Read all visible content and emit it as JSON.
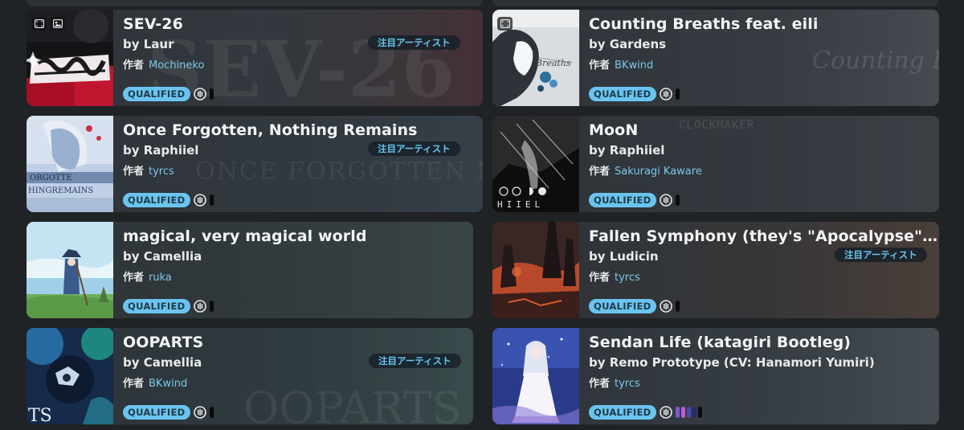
{
  "status_colors": {
    "qualified_bg": "#6bc4ef",
    "qualified_text": "#1f3a49",
    "spotlight_text": "#66c6f0",
    "mapper_name": "#7cc6ea"
  },
  "beatmaps": [
    {
      "title": "SEV-26",
      "artist": "by Laur",
      "mapper_label": "作者",
      "mapper": "Mochineko",
      "status": "QUALIFIED",
      "spotlight": "注目アーティスト",
      "has_video": true,
      "has_storyboard": true,
      "mode_icon": "osu-standard-icon",
      "difficulty_colors": [
        "#0b0b0b"
      ],
      "ghost_text": "SEV-26"
    },
    {
      "title": "Counting Breaths feat. eili",
      "artist": "by Gardens",
      "mapper_label": "作者",
      "mapper": "BKwind",
      "status": "QUALIFIED",
      "spotlight": "",
      "has_video": true,
      "has_storyboard": false,
      "mode_icon": "osu-standard-icon",
      "difficulty_colors": [
        "#0b0b0b"
      ],
      "ghost_text": "Counting Breaths"
    },
    {
      "title": "Once Forgotten, Nothing Remains",
      "artist": "by Raphiiel",
      "mapper_label": "作者",
      "mapper": "tyrcs",
      "status": "QUALIFIED",
      "spotlight": "注目アーティスト",
      "has_video": false,
      "has_storyboard": false,
      "mode_icon": "osu-standard-icon",
      "difficulty_colors": [
        "#0b0b0b"
      ],
      "ghost_text": "ONCE FORGOTTEN NOTHING REMAINS"
    },
    {
      "title": "MooN",
      "artist": "by Raphiiel",
      "mapper_label": "作者",
      "mapper": "Sakuragi Kaware",
      "status": "QUALIFIED",
      "spotlight": "",
      "has_video": false,
      "has_storyboard": false,
      "mode_icon": "osu-standard-icon",
      "difficulty_colors": [
        "#0b0b0b"
      ],
      "ghost_text": "CLOCKMAKER"
    },
    {
      "title": "magical, very magical world",
      "artist": "by Camellia",
      "mapper_label": "作者",
      "mapper": "ruka",
      "status": "QUALIFIED",
      "spotlight": "",
      "has_video": false,
      "has_storyboard": false,
      "mode_icon": "osu-standard-icon",
      "difficulty_colors": [
        "#0b0b0b"
      ],
      "ghost_text": ""
    },
    {
      "title": "Fallen Symphony (they's \"Apocalypse\" Bootleg)",
      "artist": "by Ludicin",
      "mapper_label": "作者",
      "mapper": "tyrcs",
      "status": "QUALIFIED",
      "spotlight": "注目アーティスト",
      "has_video": false,
      "has_storyboard": false,
      "mode_icon": "osu-standard-icon",
      "difficulty_colors": [
        "#0b0b0b"
      ],
      "ghost_text": ""
    },
    {
      "title": "OOPARTS",
      "artist": "by Camellia",
      "mapper_label": "作者",
      "mapper": "BKwind",
      "status": "QUALIFIED",
      "spotlight": "注目アーティスト",
      "has_video": false,
      "has_storyboard": false,
      "mode_icon": "osu-standard-icon",
      "difficulty_colors": [
        "#0b0b0b"
      ],
      "ghost_text": "OOPARTS"
    },
    {
      "title": "Sendan Life (katagiri Bootleg)",
      "artist": "by Remo Prototype (CV: Hanamori Yumiri)",
      "mapper_label": "作者",
      "mapper": "tyrcs",
      "status": "QUALIFIED",
      "spotlight": "",
      "has_video": false,
      "has_storyboard": false,
      "mode_icon": "osu-standard-icon",
      "difficulty_colors": [
        "#7a5ad8",
        "#c45ad8",
        "#4a4aa8",
        "#2a2a70",
        "#0b0b0b"
      ],
      "ghost_text": ""
    }
  ]
}
